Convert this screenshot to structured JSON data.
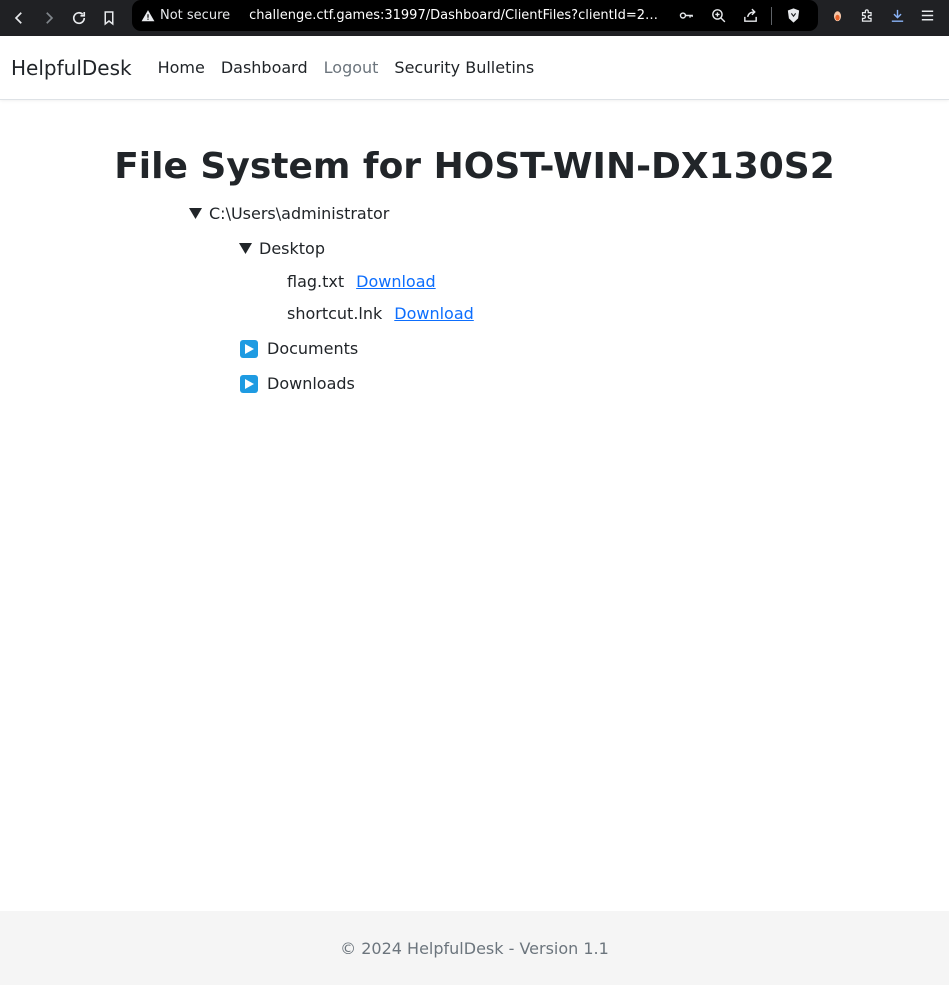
{
  "browser": {
    "security_label": "Not secure",
    "url": "challenge.ctf.games:31997/Dashboard/ClientFiles?clientId=28bfb..."
  },
  "navbar": {
    "brand": "HelpfulDesk",
    "links": [
      "Home",
      "Dashboard",
      "Logout",
      "Security Bulletins"
    ]
  },
  "page": {
    "title": "File System for HOST-WIN-DX130S2"
  },
  "tree": {
    "root": {
      "label": "C:\\Users\\administrator",
      "expanded": true
    },
    "desktop": {
      "label": "Desktop",
      "expanded": true,
      "files": [
        {
          "name": "flag.txt",
          "action": " Download"
        },
        {
          "name": "shortcut.lnk",
          "action": " Download"
        }
      ]
    },
    "documents": {
      "label": "Documents",
      "expanded": false
    },
    "downloads": {
      "label": "Downloads",
      "expanded": false
    }
  },
  "footer": {
    "text": "© 2024 HelpfulDesk - Version 1.1"
  },
  "colors": {
    "accent_link": "#0d6efd",
    "folder_icon": "#1e9be2"
  }
}
